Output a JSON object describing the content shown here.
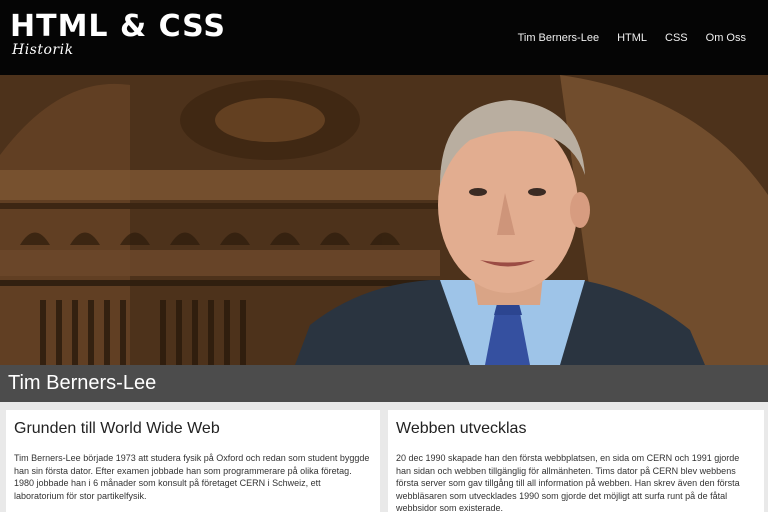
{
  "header": {
    "logo_title": "HTML & CSS",
    "logo_subtitle": "Historik",
    "nav": [
      {
        "label": "Tim Berners-Lee"
      },
      {
        "label": "HTML"
      },
      {
        "label": "CSS"
      },
      {
        "label": "Om Oss"
      }
    ]
  },
  "hero": {
    "image_icon": "portrait-photo"
  },
  "title_bar": {
    "title": "Tim Berners-Lee"
  },
  "cards": [
    {
      "heading": "Grunden till World Wide Web",
      "text": "Tim Berners-Lee började 1973 att studera fysik på Oxford och redan som student byggde han sin första dator. Efter examen jobbade han som programmerare på olika företag. 1980 jobbade han i 6 månader som konsult på företaget CERN i Schweiz, ett laboratorium för stor partikelfysik."
    },
    {
      "heading": "Webben utvecklas",
      "text": "20 dec 1990 skapade han den första webbplatsen, en sida om CERN och 1991 gjorde han sidan och webben tillgänglig för allmänheten. Tims dator på CERN blev webbens första server som gav tillgång till all information på webben. Han skrev även den första webbläsaren som utvecklades 1990 som gjorde det möjligt att surfa runt på de fåtal webbsidor som existerade."
    }
  ]
}
